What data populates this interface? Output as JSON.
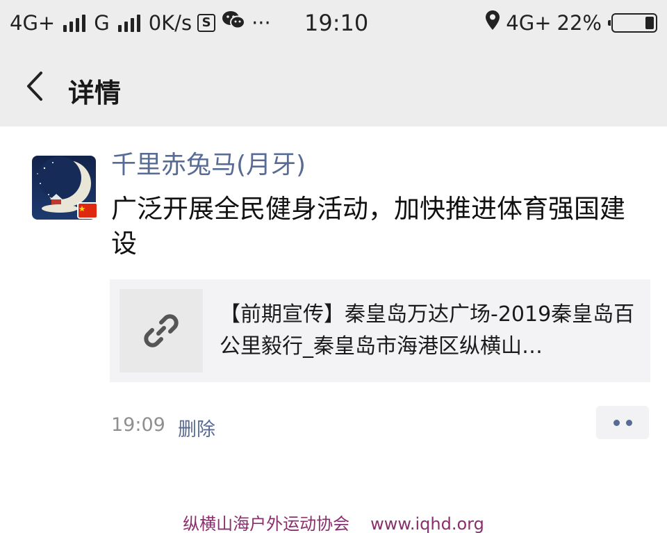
{
  "status_bar": {
    "network1": "4G+",
    "network2": "G",
    "speed": "0K/s",
    "s_icon": "S",
    "wechat_icon": "wechat-icon",
    "more_dots": "···",
    "time": "19:10",
    "network3": "4G",
    "network3_suffix": "+",
    "battery": "22%",
    "battery_level": 0.22
  },
  "nav": {
    "back_icon": "chevron-left-icon",
    "title": "详情"
  },
  "post": {
    "author": "千里赤兔马(月牙)",
    "text": "广泛开展全民健身活动，加快推进体育强国建设",
    "link": {
      "icon": "link-icon",
      "title": "【前期宣传】秦皇岛万达广场-2019秦皇岛百公里毅行_秦皇岛市海港区纵横山…"
    },
    "time": "19:09",
    "delete_label": "删除",
    "more_icon": "more-dots-icon"
  },
  "watermark": {
    "org": "纵横山海户外运动协会",
    "url": "www.iqhd.org"
  },
  "colors": {
    "accent": "#576b95",
    "bar_bg": "#ededed",
    "card_bg": "#f3f3f5",
    "watermark": "#8a2f6d"
  }
}
